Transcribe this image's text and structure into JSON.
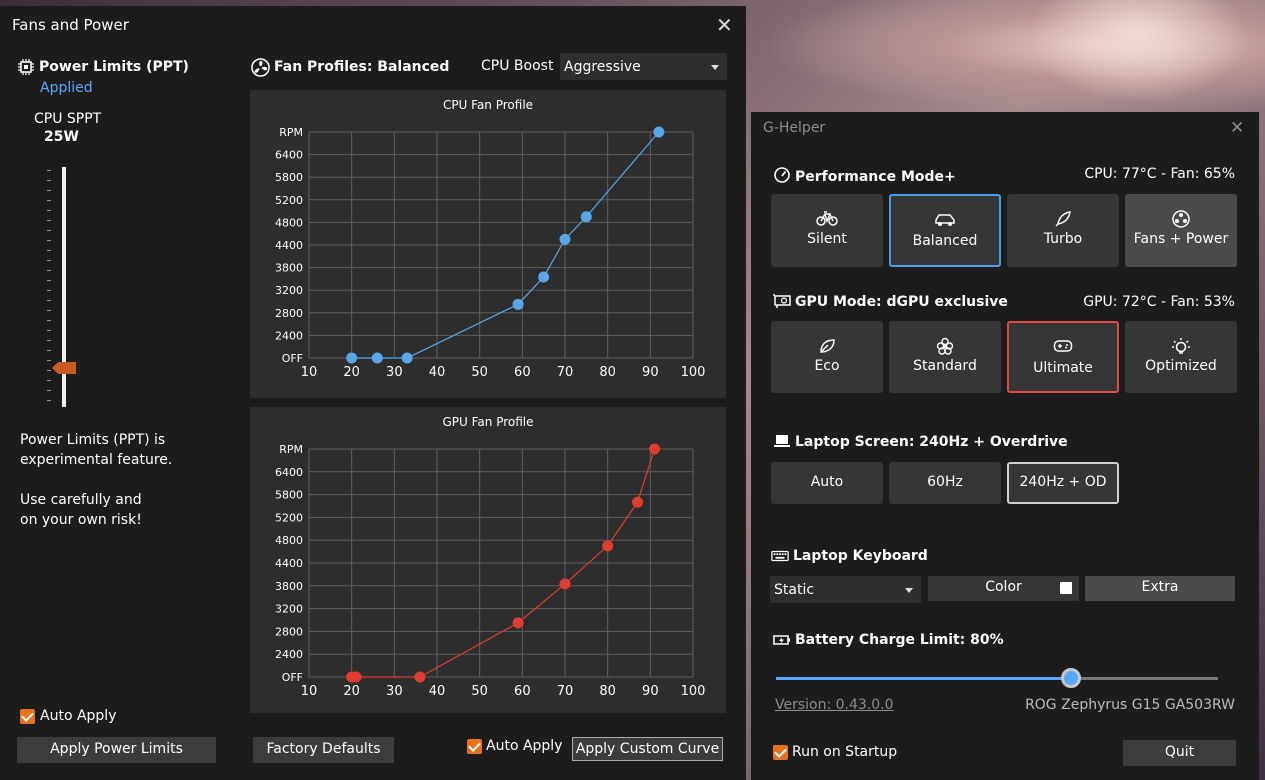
{
  "fans_window": {
    "title": "Fans and Power",
    "power_limits_title": "Power Limits (PPT)",
    "applied_label": "Applied",
    "cpu_sppt_label": "CPU SPPT",
    "cpu_sppt_value": "25W",
    "warning_line1": "Power Limits (PPT) is",
    "warning_line2": "experimental feature.",
    "warning_line3": "Use carefully and",
    "warning_line4": "on your own risk!",
    "auto_apply_left": "Auto Apply",
    "apply_power_button": "Apply Power Limits",
    "fan_profiles_title": "Fan Profiles: Balanced",
    "cpu_boost_label": "CPU Boost",
    "cpu_boost_value": "Aggressive",
    "factory_defaults_button": "Factory Defaults",
    "auto_apply_right": "Auto Apply",
    "apply_curve_button": "Apply Custom Curve"
  },
  "chart_data": [
    {
      "type": "line",
      "title": "CPU Fan Profile",
      "color": "#5aa7e8",
      "x": [
        20,
        26,
        33,
        59,
        65,
        70,
        75,
        92
      ],
      "y": [
        0,
        0,
        0,
        2950,
        3550,
        4500,
        4900,
        7000
      ],
      "xticks": [
        "10",
        "20",
        "30",
        "40",
        "50",
        "60",
        "70",
        "80",
        "90",
        "100"
      ],
      "yticks": [
        "OFF",
        "2400",
        "2800",
        "3200",
        "3800",
        "4400",
        "4800",
        "5200",
        "5800",
        "6400",
        "RPM"
      ],
      "grid": true
    },
    {
      "type": "line",
      "title": "GPU Fan Profile",
      "color": "#e03c31",
      "x": [
        20,
        21,
        36,
        59,
        70,
        80,
        87,
        91
      ],
      "y": [
        0,
        0,
        0,
        2950,
        3850,
        4700,
        5600,
        7000
      ],
      "xticks": [
        "10",
        "20",
        "30",
        "40",
        "50",
        "60",
        "70",
        "80",
        "90",
        "100"
      ],
      "yticks": [
        "OFF",
        "2400",
        "2800",
        "3200",
        "3800",
        "4400",
        "4800",
        "5200",
        "5800",
        "6400",
        "RPM"
      ],
      "grid": true
    }
  ],
  "gh_window": {
    "title": "G-Helper",
    "perf_title": "Performance Mode+",
    "perf_stat": "CPU: 77°C -  Fan: 65%",
    "perf_modes": [
      "Silent",
      "Balanced",
      "Turbo",
      "Fans + Power"
    ],
    "gpu_title": "GPU Mode: dGPU exclusive",
    "gpu_stat": "GPU: 72°C -  Fan: 53%",
    "gpu_modes": [
      "Eco",
      "Standard",
      "Ultimate",
      "Optimized"
    ],
    "screen_title": "Laptop Screen: 240Hz + Overdrive",
    "screen_modes": [
      "Auto",
      "60Hz",
      "240Hz + OD"
    ],
    "keyboard_title": "Laptop Keyboard",
    "keyboard_mode": "Static",
    "keyboard_color": "Color",
    "keyboard_extra": "Extra",
    "battery_title": "Battery Charge Limit: 80%",
    "battery_limit_percent": 80,
    "version": "Version: 0.43.0.0",
    "model": "ROG Zephyrus G15 GA503RW",
    "run_on_startup": "Run on Startup",
    "quit_button": "Quit"
  },
  "colors": {
    "accent_blue": "#5aa7ff",
    "accent_orange": "#e8711c",
    "selected_red": "#e24a3f"
  }
}
